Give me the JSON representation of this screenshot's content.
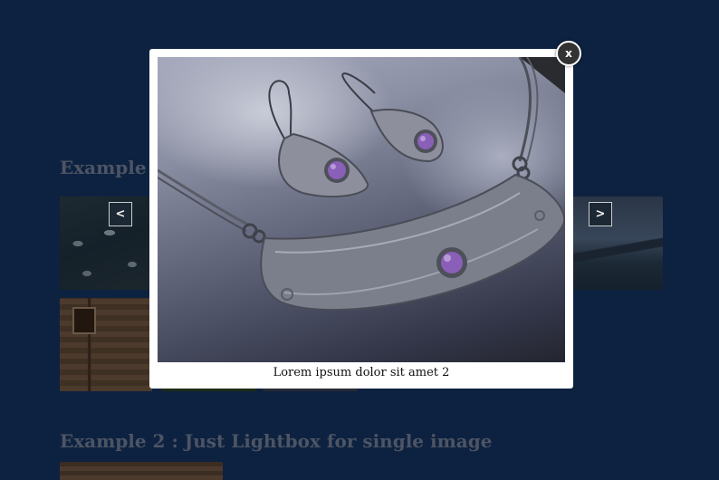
{
  "page": {
    "sections": [
      {
        "title": "Example 1"
      },
      {
        "title": "Example 2 : Just Lightbox for single image"
      }
    ],
    "gallery": {
      "prev_label": "<",
      "next_label": ">"
    }
  },
  "lightbox": {
    "caption": "Lorem ipsum dolor sit amet 2",
    "close_label": "x"
  },
  "colors": {
    "background": "#0d2240",
    "lightbox_frame": "#ffffff",
    "close_button": "#333333",
    "accent_gem": "#8a5fb8"
  }
}
